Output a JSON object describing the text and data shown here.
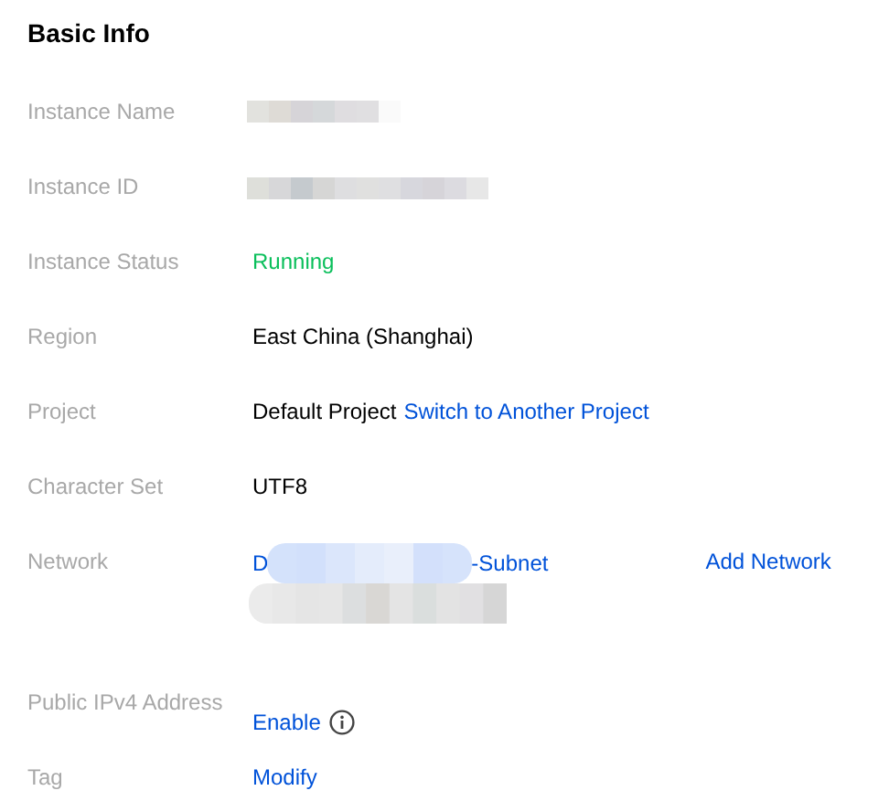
{
  "title": "Basic Info",
  "rows": [
    {
      "kind": "hidden",
      "label": "Instance Name"
    },
    {
      "kind": "hidden",
      "label": "Instance ID"
    },
    {
      "kind": "status",
      "label": "Instance Status",
      "value": "Running"
    },
    {
      "kind": "text",
      "label": "Region",
      "value": "East China (Shanghai)"
    },
    {
      "kind": "text_link",
      "label": "Project",
      "value": "Default Project",
      "link": "Switch to Another Project"
    },
    {
      "kind": "text",
      "label": "Character Set",
      "value": "UTF8"
    },
    {
      "kind": "network",
      "label": "Network",
      "prefix": "D",
      "suffix": "-Subnet",
      "action": "Add Network"
    },
    {
      "kind": "link_info",
      "label": "Public IPv4 Address",
      "link": "Enable"
    },
    {
      "kind": "link",
      "label": "Tag",
      "link": "Modify"
    }
  ]
}
